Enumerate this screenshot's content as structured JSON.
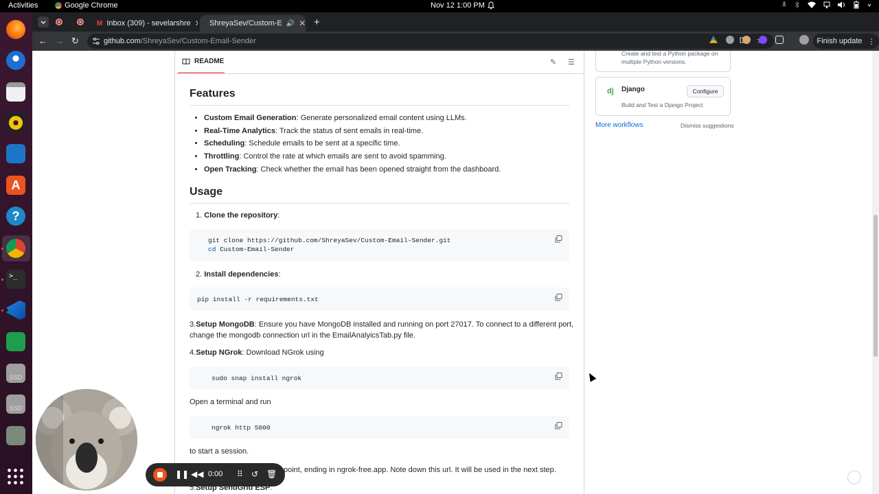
{
  "system_bar": {
    "activities": "Activities",
    "app_name": "Google Chrome",
    "clock": "Nov 12  1:00 PM"
  },
  "browser": {
    "tabs": [
      {
        "label": "Inbox (309) - sevelarshre"
      },
      {
        "label": "ShreyaSev/Custom-E"
      }
    ],
    "url_host": "github.com",
    "url_path": "/ShreyaSev/Custom-Email-Sender",
    "finish_update": "Finish update"
  },
  "readme": {
    "tab_label": "README",
    "features_heading": "Features",
    "features": [
      {
        "bold": "Custom Email Generation",
        "text": ": Generate personalized email content using LLMs."
      },
      {
        "bold": "Real-Time Analytics",
        "text": ": Track the status of sent emails in real-time."
      },
      {
        "bold": "Scheduling",
        "text": ": Schedule emails to be sent at a specific time."
      },
      {
        "bold": "Throttling",
        "text": ": Control the rate at which emails are sent to avoid spamming."
      },
      {
        "bold": "Open Tracking",
        "text": ": Check whether the email has been opened straight from the dashboard."
      }
    ],
    "usage_heading": "Usage",
    "step1": {
      "num": "1.",
      "bold": "Clone the repository",
      "colon": ":"
    },
    "code1_line1": "git clone https://github.com/ShreyaSev/Custom-Email-Sender.git",
    "code1_line2_kw": "cd",
    "code1_line2_rest": " Custom-Email-Sender",
    "step2": {
      "num": "2.",
      "bold": "Install dependencies",
      "colon": ":"
    },
    "code2": "pip install -r requirements.txt",
    "step3": {
      "num": "3.",
      "bold": "Setup MongoDB",
      "text1": ": Ensure you have MongoDB installed and running on port 27017. To connect to a different port,",
      "text2": "change the mongodb connection url in the EmailAnalyicsTab.py file."
    },
    "step4": {
      "num": "4.",
      "bold": "Setup NGrok",
      "text": ": Download NGrok using"
    },
    "code3": "sudo snap install ngrok",
    "open_terminal": "Open a terminal and run",
    "code4": "ngrok http 5000",
    "start_session": "to start a session.",
    "partial_line": "point, ending in ngrok-free.app. Note down this url. It will be used in the next step.",
    "step5": {
      "num": "5.",
      "bold": "Setup SendGrid ESP",
      "colon": ":"
    }
  },
  "sidebar": {
    "python_card_desc1": "Create and test a Python package on",
    "python_card_desc2": "multiple Python versions.",
    "django_icon": "dj",
    "django_title": "Django",
    "django_desc": "Build and Test a Django Project",
    "configure": "Configure",
    "more_workflows": "More workflows",
    "dismiss": "Dismiss suggestions"
  },
  "recorder": {
    "time": "0:00"
  },
  "colors": {
    "accent_orange": "#e95420",
    "link_blue": "#0969da",
    "django_green": "#0c4b33"
  }
}
